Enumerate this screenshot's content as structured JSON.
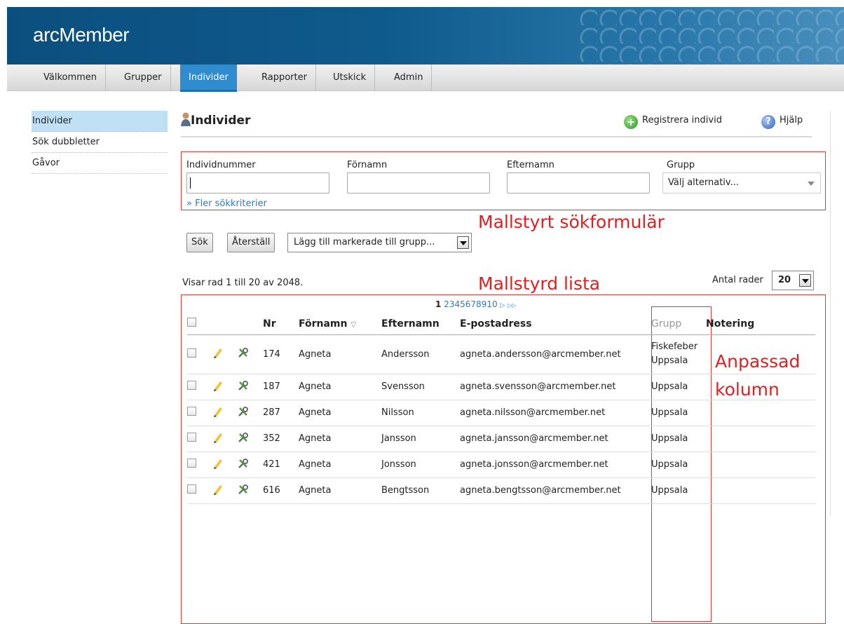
{
  "app": {
    "title": "arcMember"
  },
  "nav": {
    "tabs": [
      "Välkommen",
      "Grupper",
      "Individer",
      "Rapporter",
      "Utskick",
      "Admin"
    ],
    "active": "Individer"
  },
  "sidebar": {
    "items": [
      "Individer",
      "Sök dubbletter",
      "Gåvor"
    ]
  },
  "page": {
    "title": "Individer",
    "register_label": "Registrera individ",
    "help_label": "Hjälp"
  },
  "search": {
    "fields": [
      {
        "label": "Individnummer",
        "value": ""
      },
      {
        "label": "Förnamn",
        "value": ""
      },
      {
        "label": "Efternamn",
        "value": ""
      }
    ],
    "group_label": "Grupp",
    "group_placeholder": "Välj alternativ...",
    "more_link": "» Fler sökkriterier"
  },
  "annotations": {
    "search_form": "Mallstyrt sökformulär",
    "list": "Mallstyrd lista",
    "custom_column_line1": "Anpassad",
    "custom_column_line2": "kolumn"
  },
  "actions": {
    "search": "Sök",
    "reset": "Återställ",
    "add_to_group": "Lägg till markerade till grupp..."
  },
  "list": {
    "showing": "Visar rad 1 till 20 av 2048.",
    "rows_label": "Antal rader",
    "rows_value": "20",
    "pager": {
      "current": "1",
      "pages": [
        "2",
        "3",
        "4",
        "5",
        "6",
        "7",
        "8",
        "9",
        "10"
      ],
      "next": "▷",
      "last": "▷▷"
    },
    "columns": [
      "Nr",
      "Förnamn",
      "Efternamn",
      "E-postadress",
      "Grupp",
      "Notering"
    ],
    "rows": [
      {
        "nr": "174",
        "first": "Agneta",
        "last": "Andersson",
        "email": "agneta.andersson@arcmember.net",
        "group1": "Fiskefeber",
        "group2": "Uppsala",
        "note": ""
      },
      {
        "nr": "187",
        "first": "Agneta",
        "last": "Svensson",
        "email": "agneta.svensson@arcmember.net",
        "group1": "Uppsala",
        "group2": "",
        "note": ""
      },
      {
        "nr": "287",
        "first": "Agneta",
        "last": "Nilsson",
        "email": "agneta.nilsson@arcmember.net",
        "group1": "Uppsala",
        "group2": "",
        "note": ""
      },
      {
        "nr": "352",
        "first": "Agneta",
        "last": "Jansson",
        "email": "agneta.jansson@arcmember.net",
        "group1": "Uppsala",
        "group2": "",
        "note": ""
      },
      {
        "nr": "421",
        "first": "Agneta",
        "last": "Jonsson",
        "email": "agneta.jonsson@arcmember.net",
        "group1": "Uppsala",
        "group2": "",
        "note": ""
      },
      {
        "nr": "616",
        "first": "Agneta",
        "last": "Bengtsson",
        "email": "agneta.bengtsson@arcmember.net",
        "group1": "Uppsala",
        "group2": "",
        "note": ""
      }
    ]
  }
}
